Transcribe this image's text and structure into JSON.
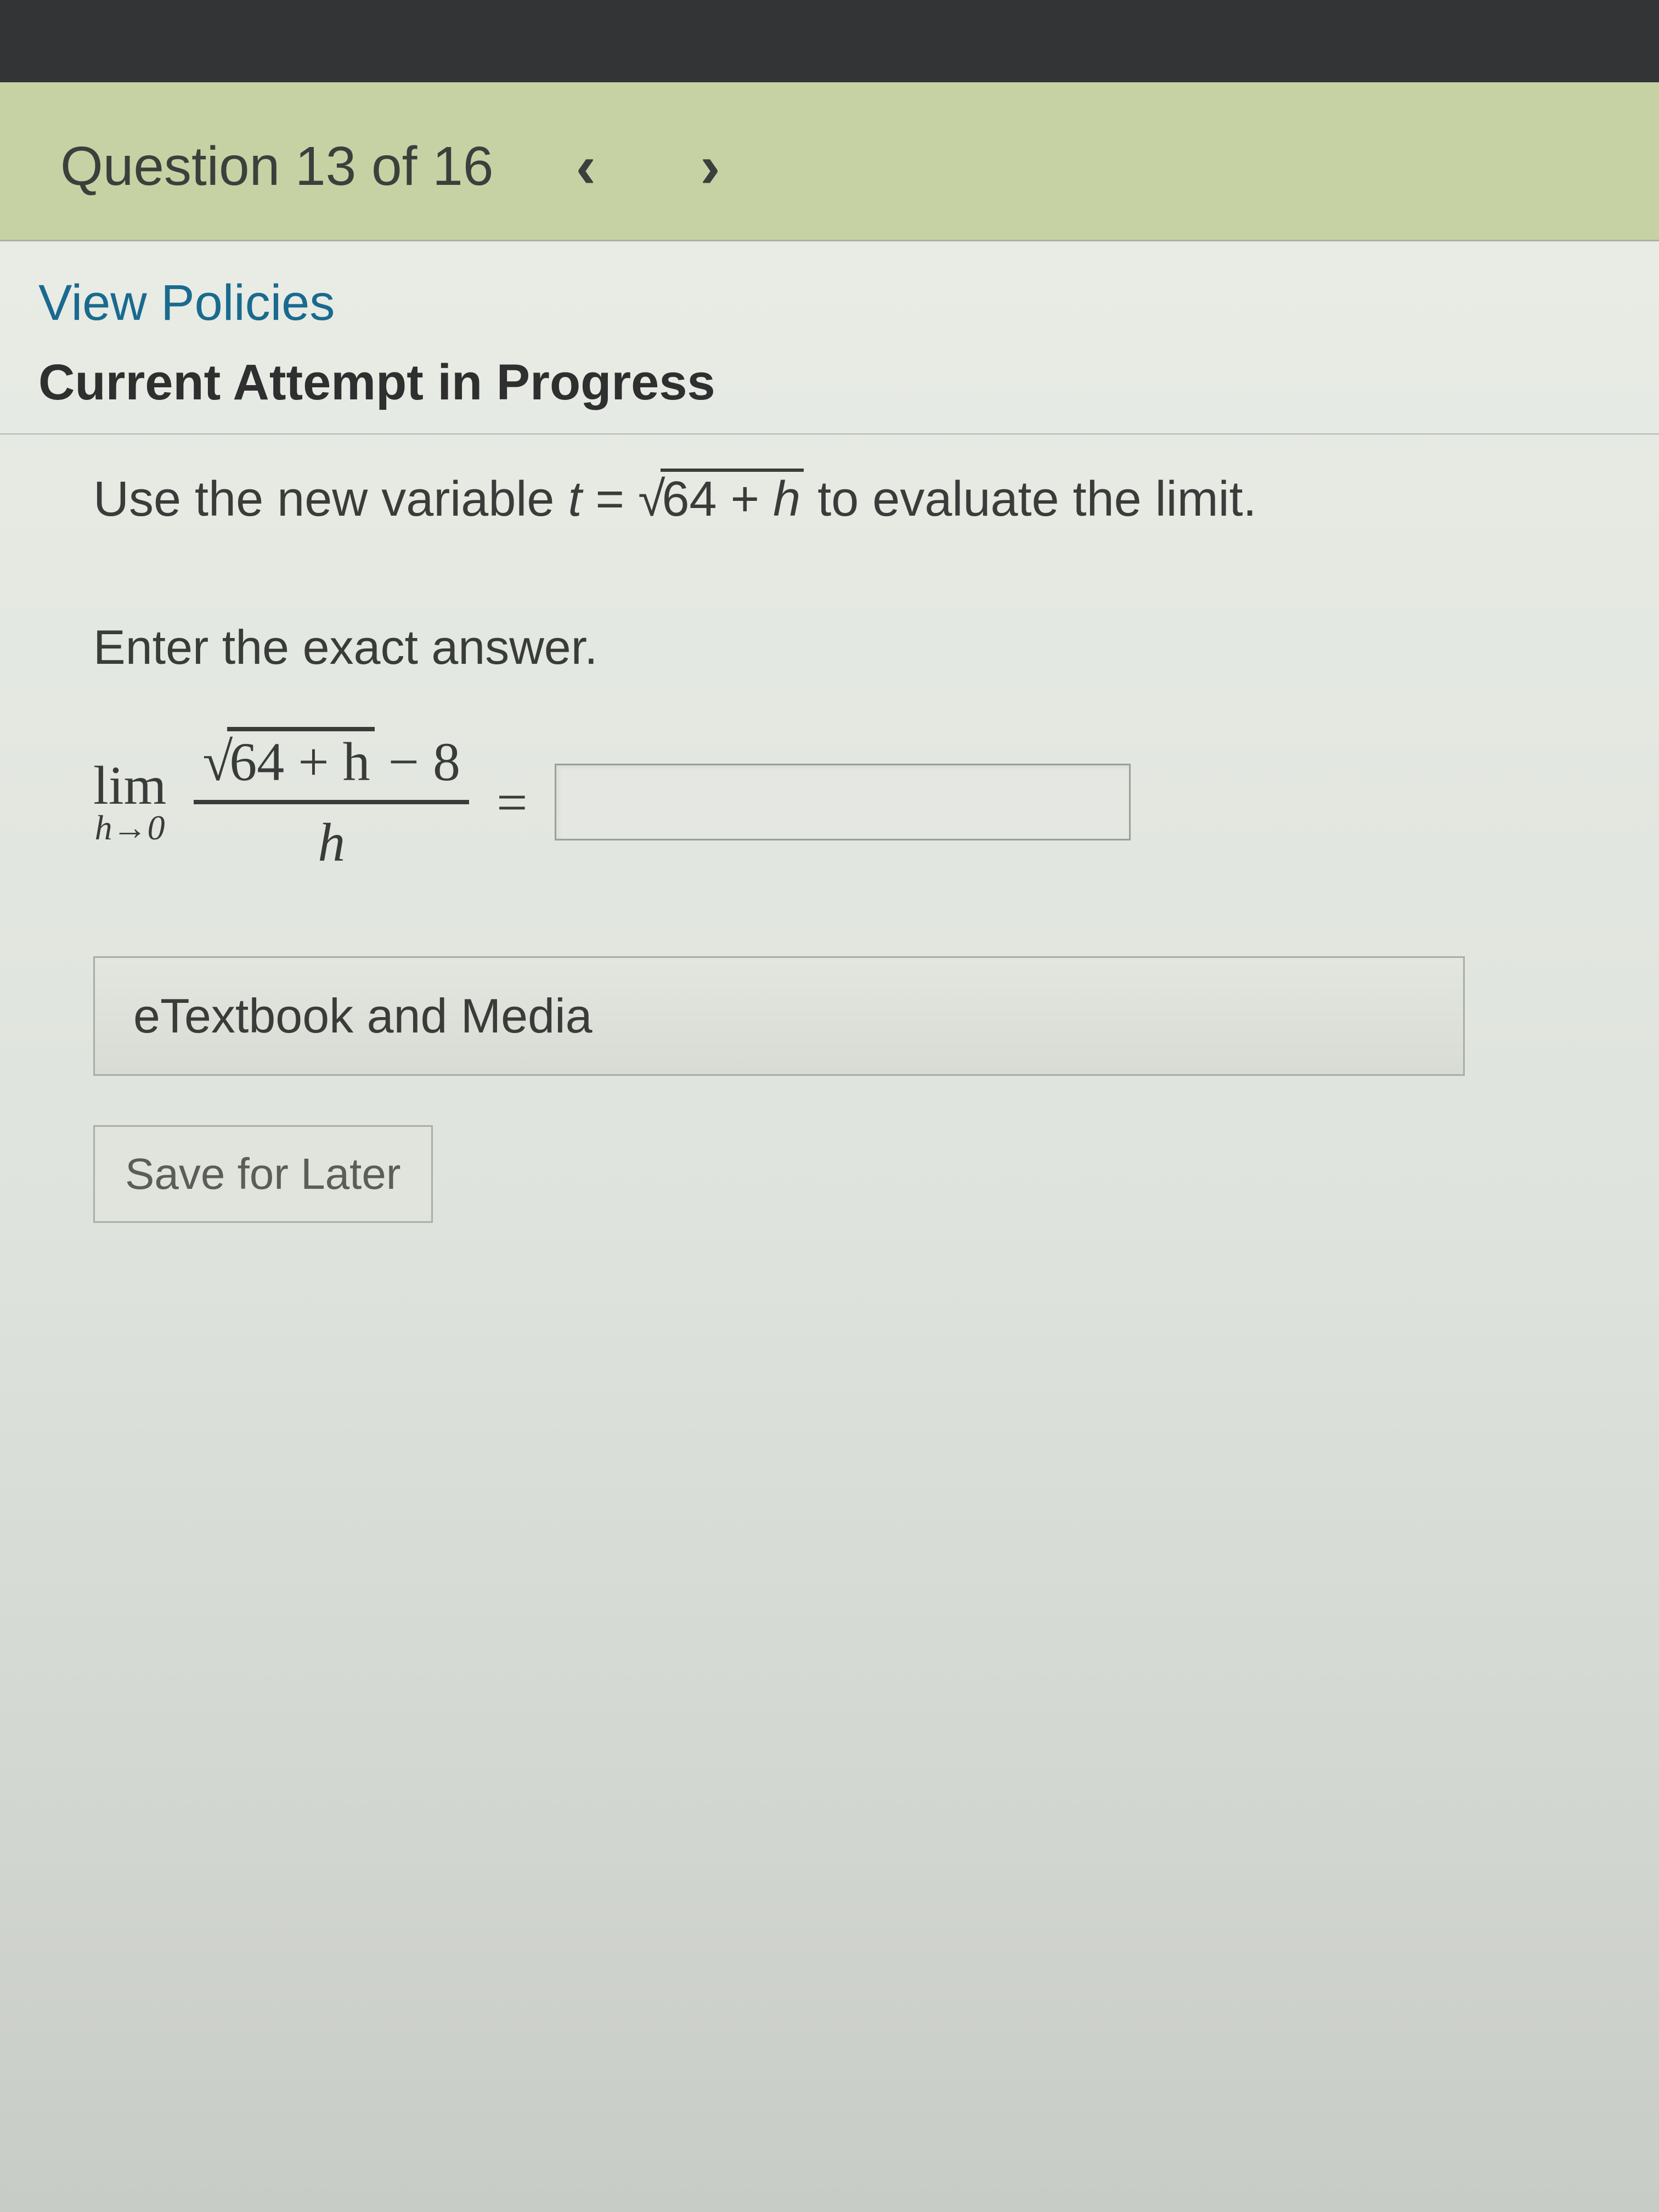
{
  "header": {
    "title": "Question 13 of 16",
    "prev_icon": "‹",
    "next_icon": "›"
  },
  "links": {
    "policies": "View Policies"
  },
  "status": {
    "attempt": "Current Attempt in Progress"
  },
  "question": {
    "prompt_pre": "Use the new variable ",
    "var_t": "t",
    "equals": " = ",
    "sqrt_sym": "√",
    "radicand_inline_a": "64 + ",
    "radicand_inline_h": "h",
    "prompt_post": " to evaluate the limit.",
    "prompt2": "Enter the exact answer.",
    "lim": "lim",
    "approach": "h→0",
    "numerator_radicand": "64 + h",
    "numerator_tail": " − 8",
    "denominator": "h",
    "eq": "=",
    "answer_value": ""
  },
  "buttons": {
    "etextbook": "eTextbook and Media",
    "save": "Save for Later"
  }
}
